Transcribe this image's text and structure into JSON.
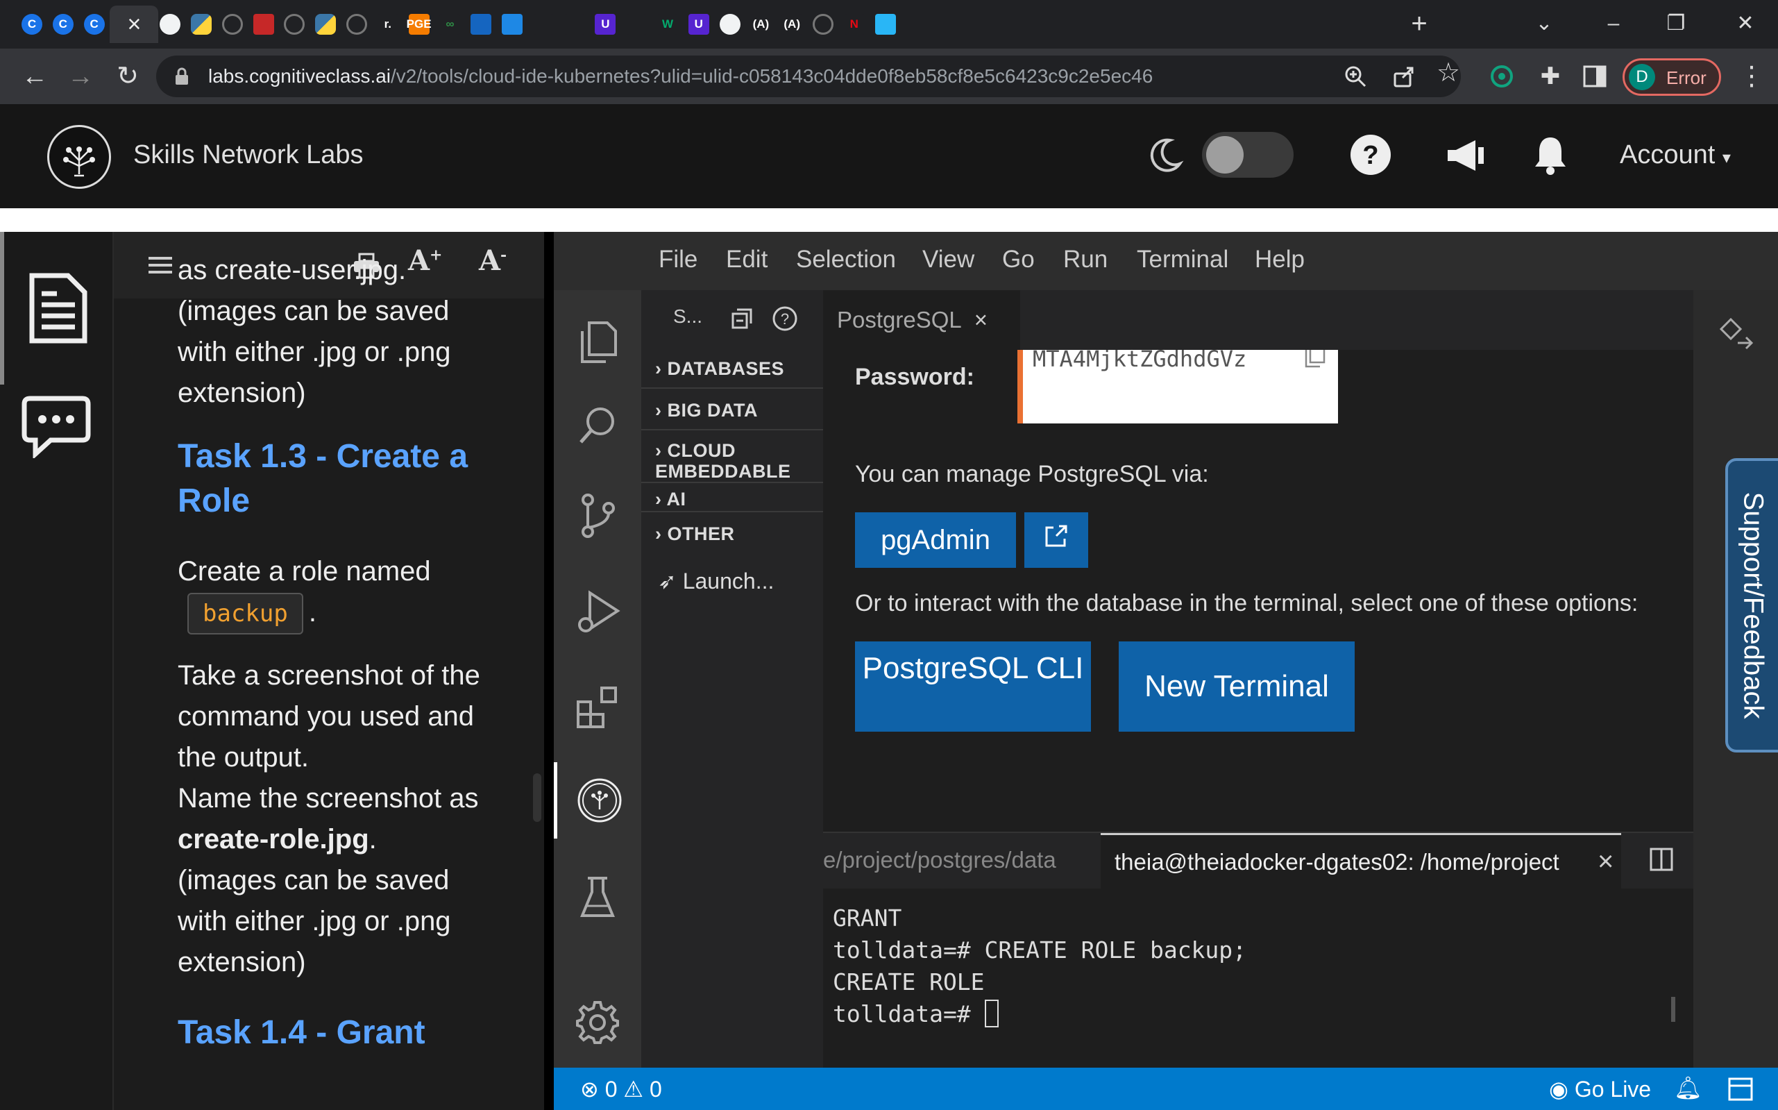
{
  "browser": {
    "tabs": [
      {
        "fav": "C",
        "kind": "c"
      },
      {
        "fav": "C",
        "kind": "c"
      },
      {
        "fav": "C",
        "kind": "c"
      },
      {
        "fav": "×",
        "kind": "active"
      },
      {
        "fav": "",
        "kind": "web"
      },
      {
        "fav": "",
        "kind": "py"
      },
      {
        "fav": "",
        "kind": "gh"
      },
      {
        "fav": "",
        "kind": "red"
      },
      {
        "fav": "",
        "kind": "gh"
      },
      {
        "fav": "",
        "kind": "py"
      },
      {
        "fav": "",
        "kind": "gh"
      },
      {
        "fav": "r.",
        "kind": "r"
      },
      {
        "fav": "PGE",
        "kind": "pge"
      },
      {
        "fav": "∞",
        "kind": "gfg"
      },
      {
        "fav": "",
        "kind": "blue"
      },
      {
        "fav": "",
        "kind": "blue2"
      },
      {
        "fav": "",
        "kind": "bird"
      },
      {
        "fav": "",
        "kind": "bird"
      },
      {
        "fav": "U",
        "kind": "udemy"
      },
      {
        "fav": "",
        "kind": "so"
      },
      {
        "fav": "W",
        "kind": "w3"
      },
      {
        "fav": "U",
        "kind": "udemy"
      },
      {
        "fav": "",
        "kind": "web"
      },
      {
        "fav": "(A)",
        "kind": "a"
      },
      {
        "fav": "(A)",
        "kind": "a"
      },
      {
        "fav": "",
        "kind": "gh"
      },
      {
        "fav": "N",
        "kind": "netflix"
      },
      {
        "fav": "",
        "kind": "blue3"
      }
    ],
    "url_host": "labs.cognitiveclass.ai",
    "url_path": "/v2/tools/cloud-ide-kubernetes?ulid=ulid-c058143c04dde0f8eb58cf8e5c6423c9c2e5ec46",
    "profile_initial": "D",
    "profile_status": "Error"
  },
  "header": {
    "brand": "Skills Network Labs",
    "account": "Account"
  },
  "instructions": {
    "top_fragment": "as create-user.jpg.",
    "p1": "(images can be saved with either .jpg or .png extension)",
    "task13": "Task 1.3 - Create a Role",
    "create_prefix": "Create a role named",
    "role_code": "backup",
    "create_suffix": ".",
    "take_shot": "Take a screenshot of the command you used and the output.",
    "name_prefix": "Name the screenshot as",
    "name_file": "create-role.jpg",
    "name_suffix": ".",
    "p2": "(images can be saved with either .jpg or .png extension)",
    "task14": "Task 1.4 - Grant"
  },
  "ide": {
    "menu": [
      "File",
      "Edit",
      "Selection",
      "View",
      "Go",
      "Run",
      "Terminal",
      "Help"
    ],
    "explorer_title": "S...",
    "explorer_items": [
      "DATABASES",
      "BIG DATA",
      "CLOUD EMBEDDABLE",
      "AI",
      "OTHER"
    ],
    "launch": "Launch...",
    "editor_tab": "PostgreSQL",
    "password_label": "Password:",
    "password_value": "MTA4MjktZGdhdGVz",
    "manage_text": "You can manage PostgreSQL via:",
    "pgadmin_btn": "pgAdmin",
    "interact_text": "Or to interact with the database in the terminal, select one of these options:",
    "cli_btn": "PostgreSQL CLI",
    "newterm_btn": "New Terminal",
    "support": "Support/Feedback",
    "term_tab1": "e/project/postgres/data",
    "term_tab2": "theia@theiadocker-dgates02: /home/project",
    "terminal_lines": "GRANT\ntolldata=# CREATE ROLE backup;\nCREATE ROLE\ntolldata=# ",
    "status_errors": "0",
    "status_warnings": "0",
    "go_live": "Go Live"
  }
}
